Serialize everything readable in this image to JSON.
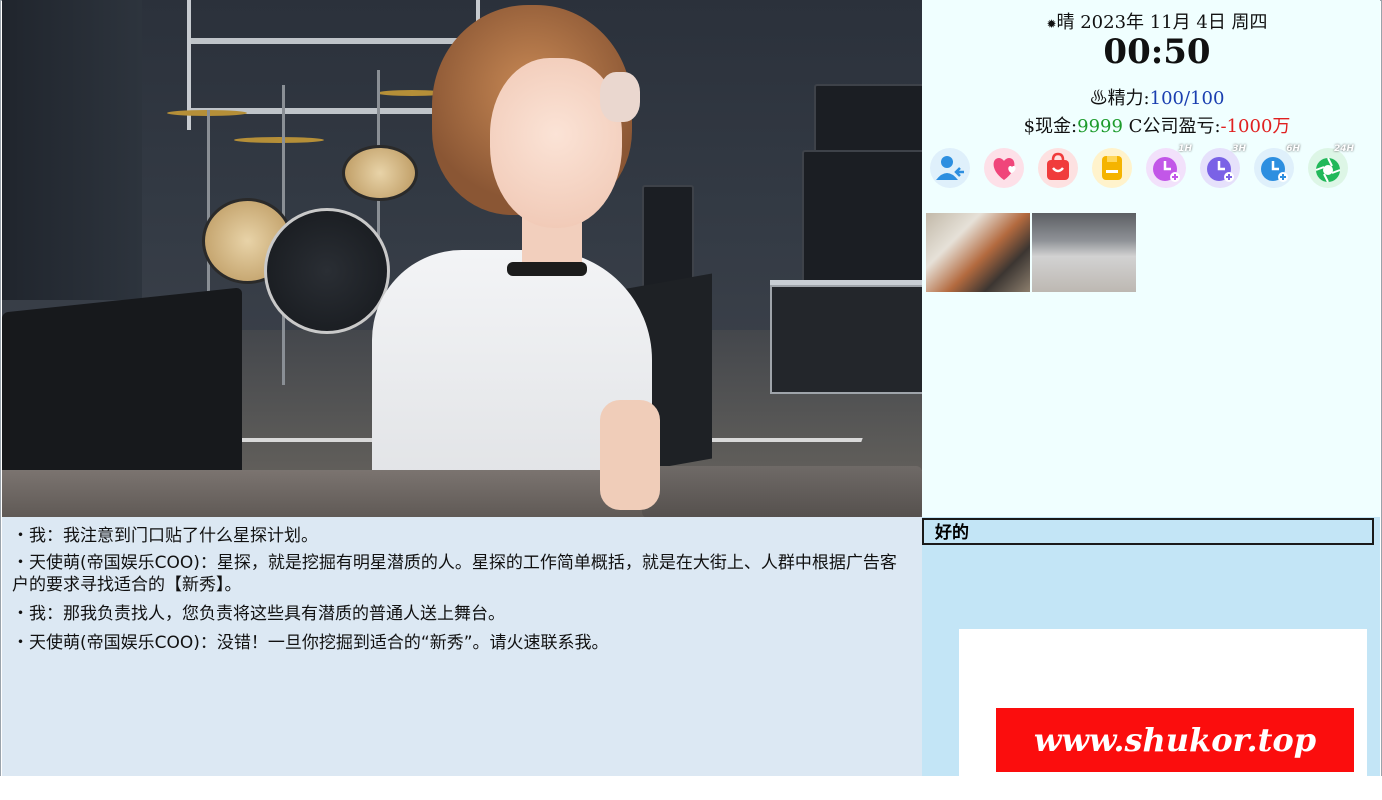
{
  "status": {
    "weather_icon": "sun-icon",
    "date": "晴 2023年 11月 4日 周四",
    "clock": "00:50",
    "energy_label": "精力:",
    "energy_value": "100/100",
    "cash_label": "$现金:",
    "cash_value": "9999",
    "company_label": "C公司盈亏:",
    "company_value": "-1000万"
  },
  "toolbar": {
    "buttons": [
      {
        "icon": "user-back-icon",
        "color": "#2d8fe0",
        "tag": ""
      },
      {
        "icon": "heart-icon",
        "color": "#f0457a",
        "tag": ""
      },
      {
        "icon": "shopping-bag-icon",
        "color": "#f03c3c",
        "tag": ""
      },
      {
        "icon": "save-icon",
        "color": "#f5b400",
        "tag": ""
      },
      {
        "icon": "clock-1h-icon",
        "color": "#c257e8",
        "tag": "1H"
      },
      {
        "icon": "clock-3h-icon",
        "color": "#7a62e6",
        "tag": "3H"
      },
      {
        "icon": "clock-6h-icon",
        "color": "#2d8fe0",
        "tag": "6H"
      },
      {
        "icon": "shutter-24h-icon",
        "color": "#22b85a",
        "tag": "24H"
      }
    ]
  },
  "locations": [
    {
      "name": "mall-corridor-thumbnail"
    },
    {
      "name": "empty-hall-thumbnail"
    }
  ],
  "dialog": {
    "lines": [
      "・我：我注意到门口贴了什么星探计划。",
      "・天使萌(帝国娱乐COO)：星探，就是挖掘有明星潜质的人。星探的工作简单概括，就是在大街上、人群中根据广告客户的要求寻找适合的【新秀】。",
      "・我：那我负责找人，您负责将这些具有潜质的普通人送上舞台。",
      "・天使萌(帝国娱乐COO)：没错！一旦你挖掘到适合的“新秀”。请火速联系我。"
    ]
  },
  "choices": {
    "ok": "好的"
  },
  "watermark": "www.shukor.top"
}
